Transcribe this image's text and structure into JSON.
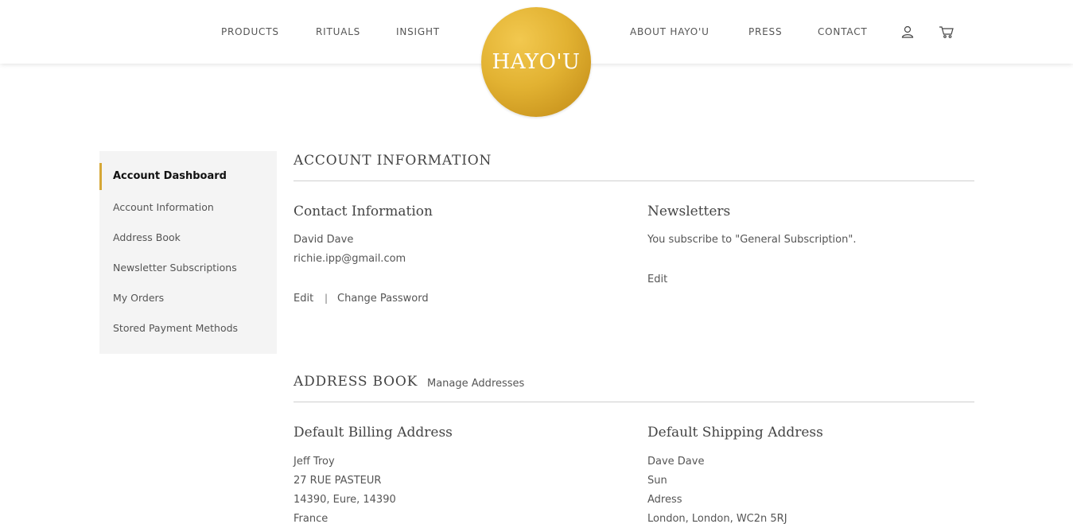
{
  "header": {
    "nav_left": [
      "PRODUCTS",
      "RITUALS",
      "INSIGHT"
    ],
    "nav_right": [
      "ABOUT HAYO'U",
      "PRESS",
      "CONTACT"
    ],
    "logo_text": "HAYO'U",
    "icons": [
      "user-icon",
      "cart-icon"
    ]
  },
  "sidebar": {
    "items": [
      {
        "label": "Account Dashboard",
        "active": true
      },
      {
        "label": "Account Information"
      },
      {
        "label": "Address Book"
      },
      {
        "label": "Newsletter Subscriptions"
      },
      {
        "label": "My Orders"
      },
      {
        "label": "Stored Payment Methods"
      }
    ]
  },
  "account_info": {
    "title": "ACCOUNT INFORMATION",
    "contact": {
      "title": "Contact Information",
      "name": "David Dave",
      "email": "richie.ipp@gmail.com",
      "edit_label": "Edit",
      "separator": "|",
      "change_password_label": "Change Password"
    },
    "newsletters": {
      "title": "Newsletters",
      "text": "You subscribe to \"General Subscription\".",
      "edit_label": "Edit"
    }
  },
  "address_book": {
    "title": "ADDRESS BOOK",
    "manage_label": "Manage Addresses",
    "billing": {
      "title": "Default Billing Address",
      "lines": [
        "Jeff Troy",
        "27 RUE PASTEUR",
        "14390, Eure, 14390",
        "France"
      ]
    },
    "shipping": {
      "title": "Default Shipping Address",
      "lines": [
        "Dave Dave",
        "Sun",
        "Adress",
        "London, London, WC2n 5RJ"
      ]
    }
  },
  "colors": {
    "accent": "#d6a736",
    "logo_gold": "#e2b232",
    "sidebar_bg": "#f4f4f4"
  }
}
